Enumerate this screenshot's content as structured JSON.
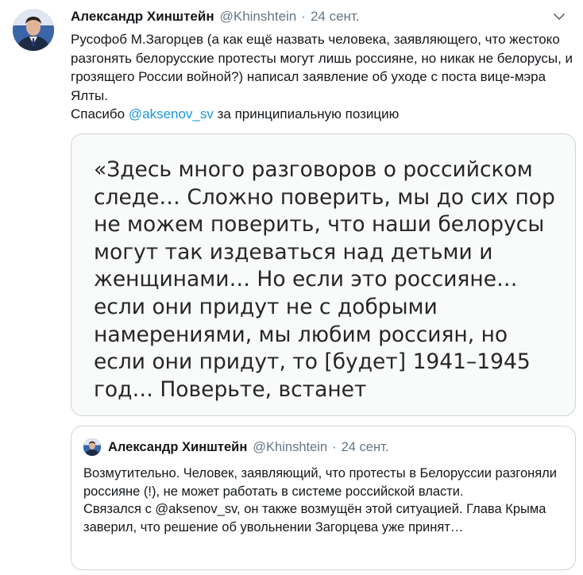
{
  "tweet": {
    "author_name": "Александр Хинштейн",
    "handle": "@Khinshtein",
    "separator": "·",
    "date": "24 сент.",
    "text_main": "Русофоб М.Загорцев (а как ещё назвать человека, заявляющего, что жестоко разгонять белорусские протесты могут лишь россияне, но никак не белорусы, и грозящего России войной?) написал заявление об уходе с поста вице-мэра Ялты.\nСпасибо ",
    "mention": "@aksenov_sv",
    "text_end": " за принципиальную позицию",
    "menu_icon": "chevron-down-icon"
  },
  "media": {
    "image_text": "«Здесь много разговоров о российском следе… Сложно поверить, мы до сих пор не можем поверить, что наши белорусы могут так издеваться над детьми и женщинами… Но если это россияне… если они придут не с добрыми намерениями, мы любим россиян, но если они придут, то [будет] 1941–1945 год… Поверьте, встанет"
  },
  "quoted_tweet": {
    "author_name": "Александр Хинштейн",
    "handle": "@Khinshtein",
    "separator": "·",
    "date": "24 сент.",
    "text": "Возмутительно. Человек, заявляющий, что протесты в Белоруссии разгоняли россияне (!), не может работать в системе российской власти.\nСвязался с @aksenov_sv, он также возмущён этой ситуацией. Глава Крыма заверил, что решение об увольнении Загорцева уже принят…"
  },
  "colors": {
    "link": "#1b95e0",
    "secondary_text": "#657786",
    "border": "#ccd6dd"
  }
}
